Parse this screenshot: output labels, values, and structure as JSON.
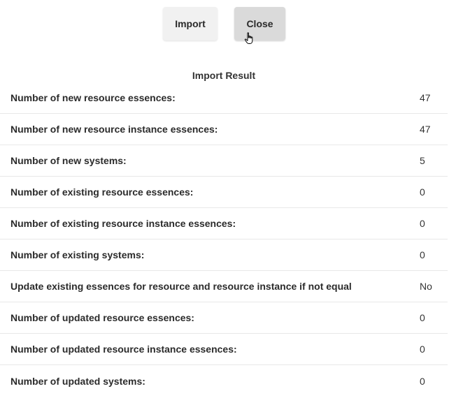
{
  "toolbar": {
    "import_label": "Import",
    "close_label": "Close"
  },
  "result": {
    "title": "Import Result",
    "rows": [
      {
        "label": "Number of new resource essences:",
        "value": "47"
      },
      {
        "label": "Number of new resource instance essences:",
        "value": "47"
      },
      {
        "label": "Number of new systems:",
        "value": "5"
      },
      {
        "label": "Number of existing resource essences:",
        "value": "0"
      },
      {
        "label": "Number of existing resource instance essences:",
        "value": "0"
      },
      {
        "label": "Number of existing systems:",
        "value": "0"
      },
      {
        "label": "Update existing essences for resource and resource instance if not equal",
        "value": "No"
      },
      {
        "label": "Number of updated resource essences:",
        "value": "0"
      },
      {
        "label": "Number of updated resource instance essences:",
        "value": "0"
      },
      {
        "label": "Number of updated systems:",
        "value": "0"
      }
    ]
  }
}
